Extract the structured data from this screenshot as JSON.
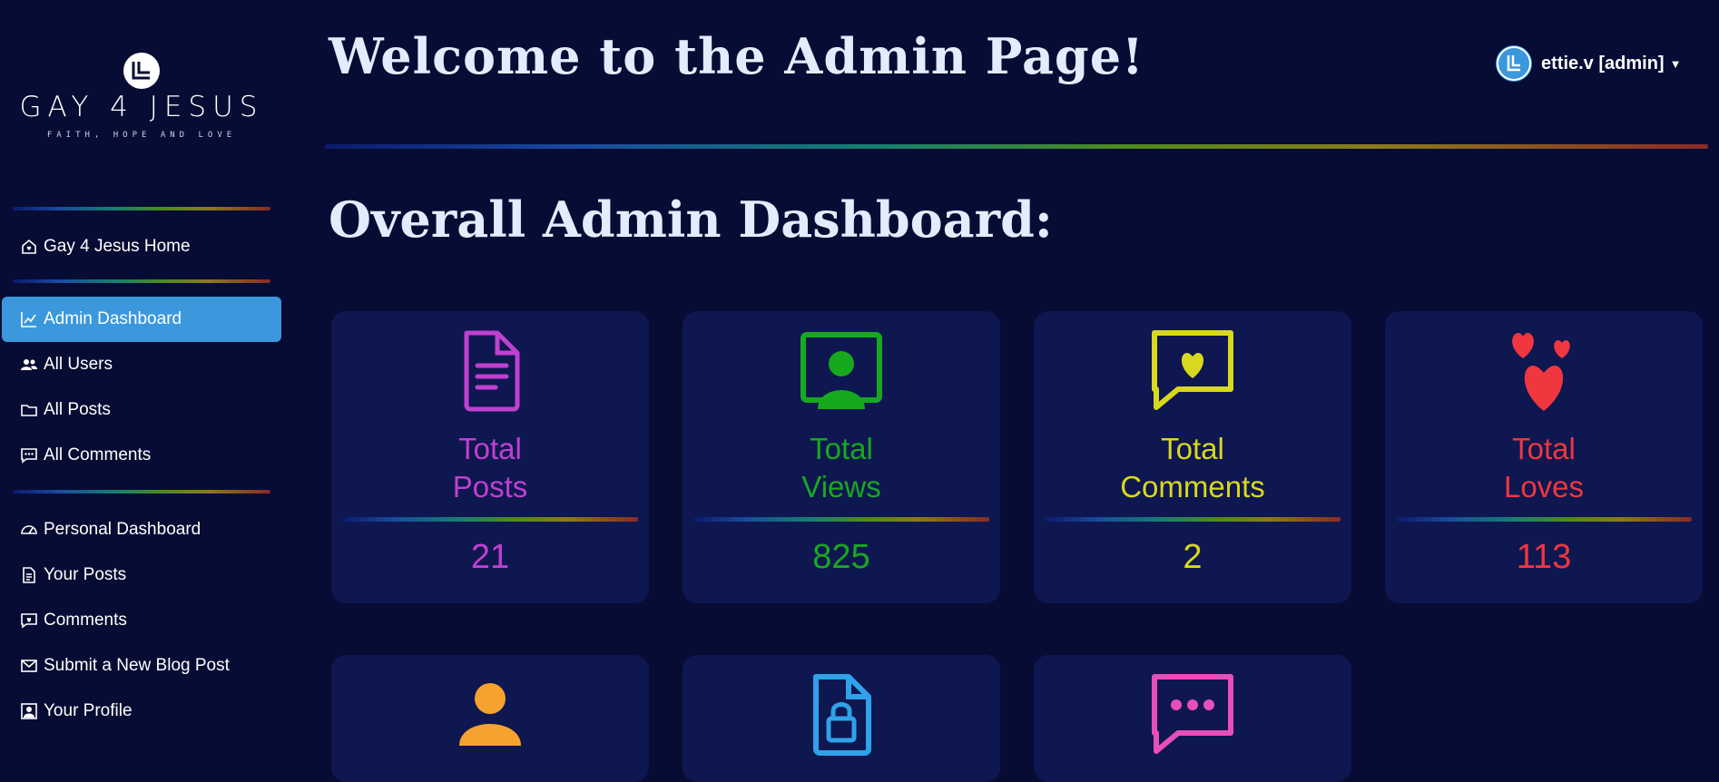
{
  "brand": {
    "title": "GAY 4 JESUS",
    "tagline": "FAITH, HOPE AND LOVE"
  },
  "sidebar": {
    "items": [
      {
        "label": "Gay 4 Jesus Home",
        "icon": "house-heart-icon"
      },
      {
        "label": "Admin Dashboard",
        "icon": "chart-line-icon",
        "active": true
      },
      {
        "label": "All Users",
        "icon": "people-icon"
      },
      {
        "label": "All Posts",
        "icon": "folder-icon"
      },
      {
        "label": "All Comments",
        "icon": "chat-dots-icon"
      },
      {
        "label": "Personal Dashboard",
        "icon": "speedometer-icon"
      },
      {
        "label": "Your Posts",
        "icon": "file-text-icon"
      },
      {
        "label": "Comments",
        "icon": "chat-heart-icon"
      },
      {
        "label": "Submit a New Blog Post",
        "icon": "envelope-icon"
      },
      {
        "label": "Your Profile",
        "icon": "person-square-icon"
      }
    ]
  },
  "header": {
    "welcome": "Welcome to the Admin Page!",
    "user": "ettie.v [admin]"
  },
  "dashboard": {
    "title": "Overall Admin Dashboard:",
    "cards": [
      {
        "label_line1": "Total",
        "label_line2": "Posts",
        "value": "21",
        "color": "#c040d0",
        "icon": "file-text-icon"
      },
      {
        "label_line1": "Total",
        "label_line2": "Views",
        "value": "825",
        "color": "#18a820",
        "icon": "person-video-icon"
      },
      {
        "label_line1": "Total",
        "label_line2": "Comments",
        "value": "2",
        "color": "#d8d81e",
        "icon": "chat-heart-icon"
      },
      {
        "label_line1": "Total",
        "label_line2": "Loves",
        "value": "113",
        "color": "#f0373f",
        "icon": "hearts-icon"
      }
    ],
    "cards_row2_icons": [
      {
        "icon": "person-icon",
        "color": "#f6a22e"
      },
      {
        "icon": "file-lock-icon",
        "color": "#2fa2ea"
      },
      {
        "icon": "chat-dots-icon",
        "color": "#e84fb8"
      }
    ]
  },
  "colors": {
    "background": "#060c33",
    "card": "#0e1750",
    "active": "#3b98dc"
  }
}
